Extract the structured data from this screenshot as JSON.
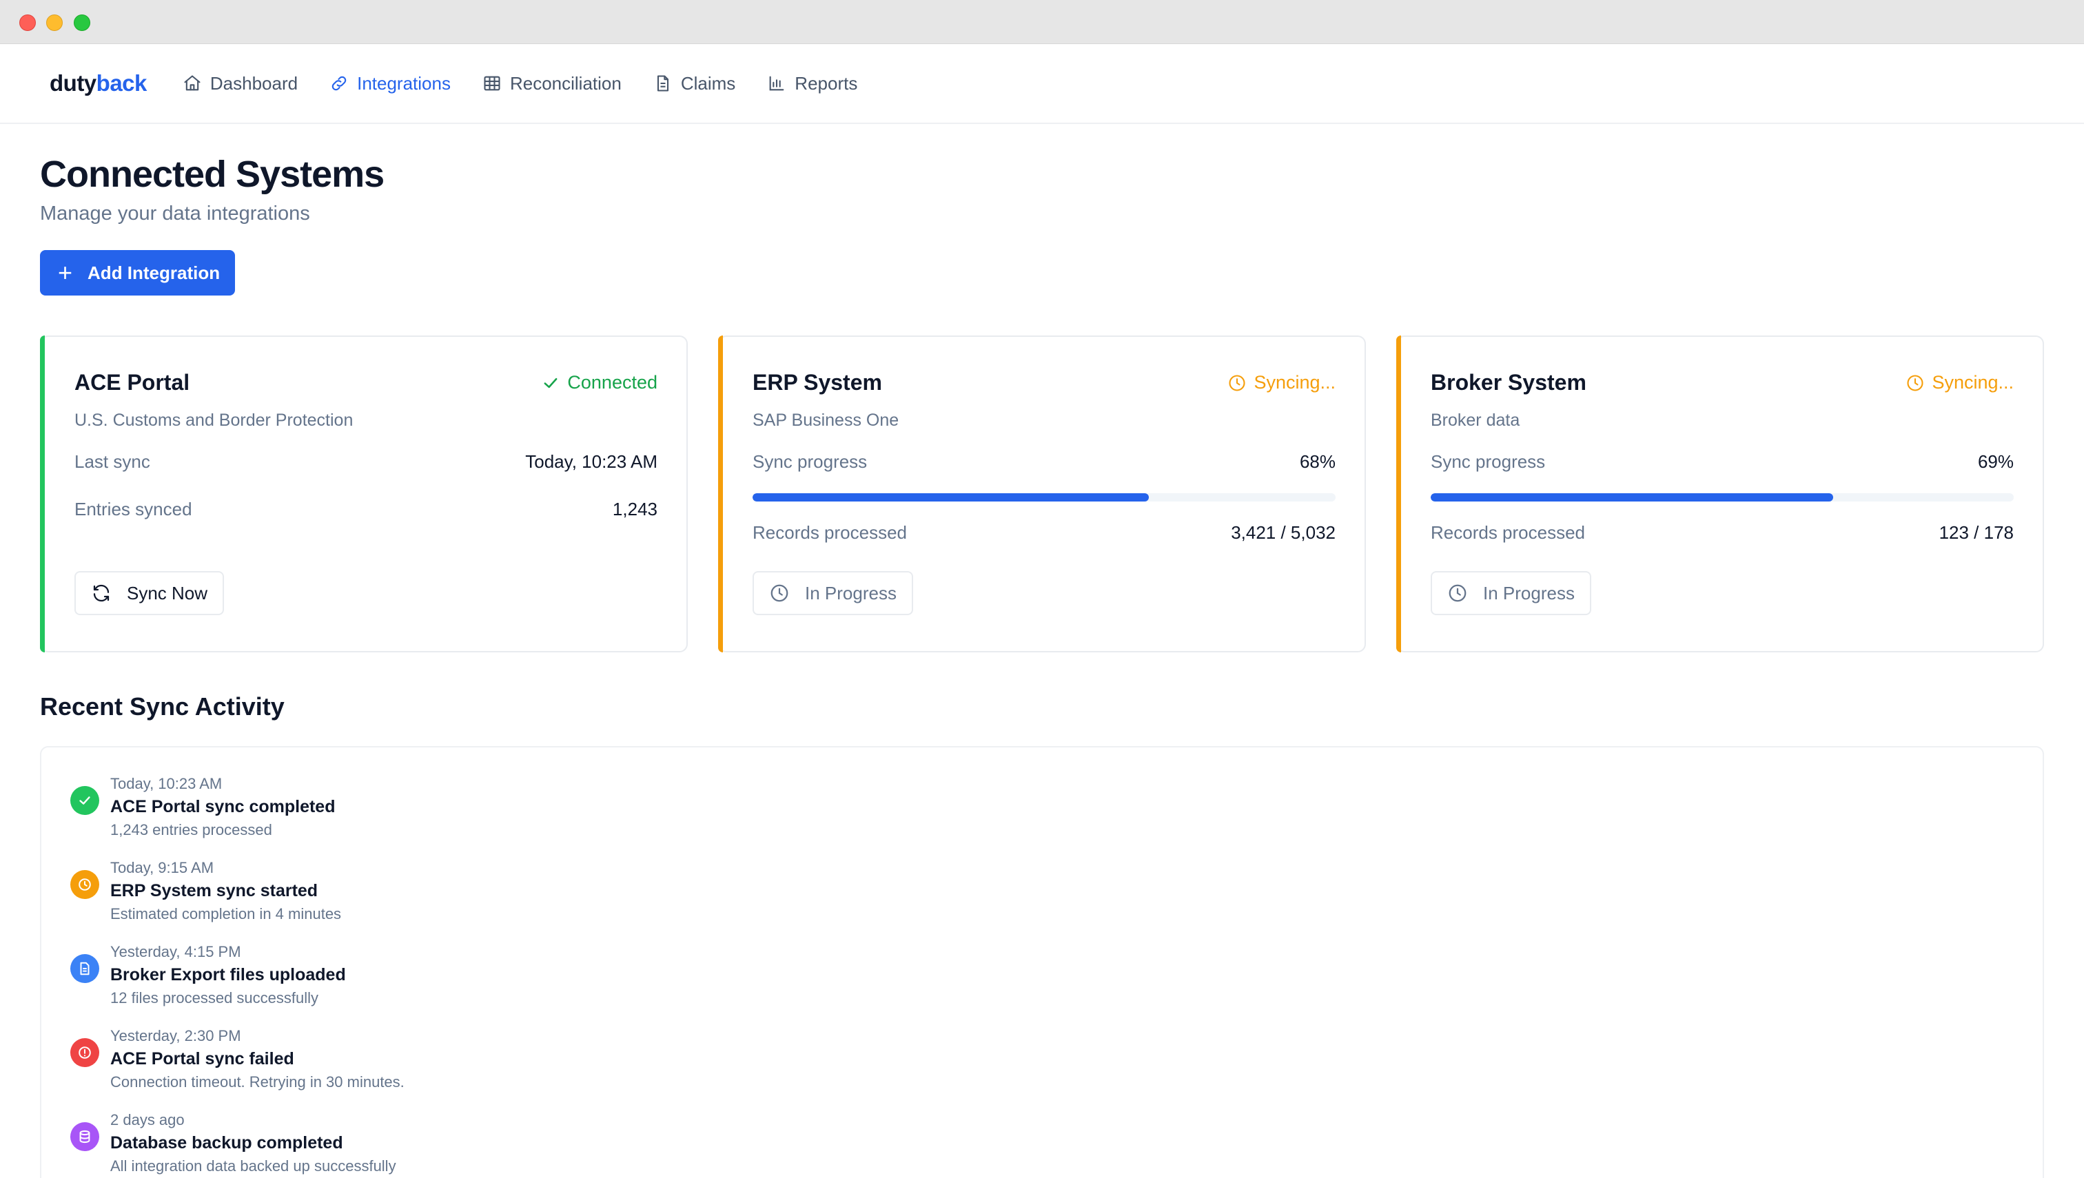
{
  "app": {
    "logo_main": "duty",
    "logo_accent": "back"
  },
  "nav": {
    "items": [
      {
        "label": "Dashboard",
        "icon": "home-icon"
      },
      {
        "label": "Integrations",
        "icon": "link-icon",
        "active": true
      },
      {
        "label": "Reconciliation",
        "icon": "table-icon"
      },
      {
        "label": "Claims",
        "icon": "document-icon"
      },
      {
        "label": "Reports",
        "icon": "bar-chart-icon"
      }
    ]
  },
  "page": {
    "title": "Connected Systems",
    "subtitle": "Manage your data integrations",
    "add_button": "Add Integration"
  },
  "cards": [
    {
      "title": "ACE Portal",
      "status": "Connected",
      "description": "U.S. Customs and Border Protection",
      "row1_label": "Last sync",
      "row1_value": "Today, 10:23 AM",
      "row2_label": "Entries synced",
      "row2_value": "1,243",
      "button": "Sync Now",
      "accent_color": "#22c55e"
    },
    {
      "title": "ERP System",
      "status": "Syncing...",
      "description": "SAP Business One",
      "row1_label": "Sync progress",
      "row1_value": "68%",
      "progress": 0.68,
      "row2_label": "Records processed",
      "row2_value": "3,421 / 5,032",
      "button": "In Progress",
      "accent_color": "#f59e0b"
    },
    {
      "title": "Broker System",
      "status": "Syncing...",
      "description": "Broker data",
      "row1_label": "Sync progress",
      "row1_value": "69%",
      "progress": 0.69,
      "row2_label": "Records processed",
      "row2_value": "123 / 178",
      "button": "In Progress",
      "accent_color": "#f59e0b"
    }
  ],
  "activity": {
    "title": "Recent Sync Activity",
    "items": [
      {
        "time": "Today, 10:23 AM",
        "title": "ACE Portal sync completed",
        "detail": "1,243 entries processed",
        "icon": "check-icon",
        "color": "#22c55e"
      },
      {
        "time": "Today, 9:15 AM",
        "title": "ERP System sync started",
        "detail": "Estimated completion in 4 minutes",
        "icon": "clock-icon",
        "color": "#f59e0b"
      },
      {
        "time": "Yesterday, 4:15 PM",
        "title": "Broker Export files uploaded",
        "detail": "12 files processed successfully",
        "icon": "file-icon",
        "color": "#3b82f6"
      },
      {
        "time": "Yesterday, 2:30 PM",
        "title": "ACE Portal sync failed",
        "detail": "Connection timeout. Retrying in 30 minutes.",
        "icon": "alert-icon",
        "color": "#ef4444"
      },
      {
        "time": "2 days ago",
        "title": "Database backup completed",
        "detail": "All integration data backed up successfully",
        "icon": "database-icon",
        "color": "#a855f7"
      }
    ]
  }
}
